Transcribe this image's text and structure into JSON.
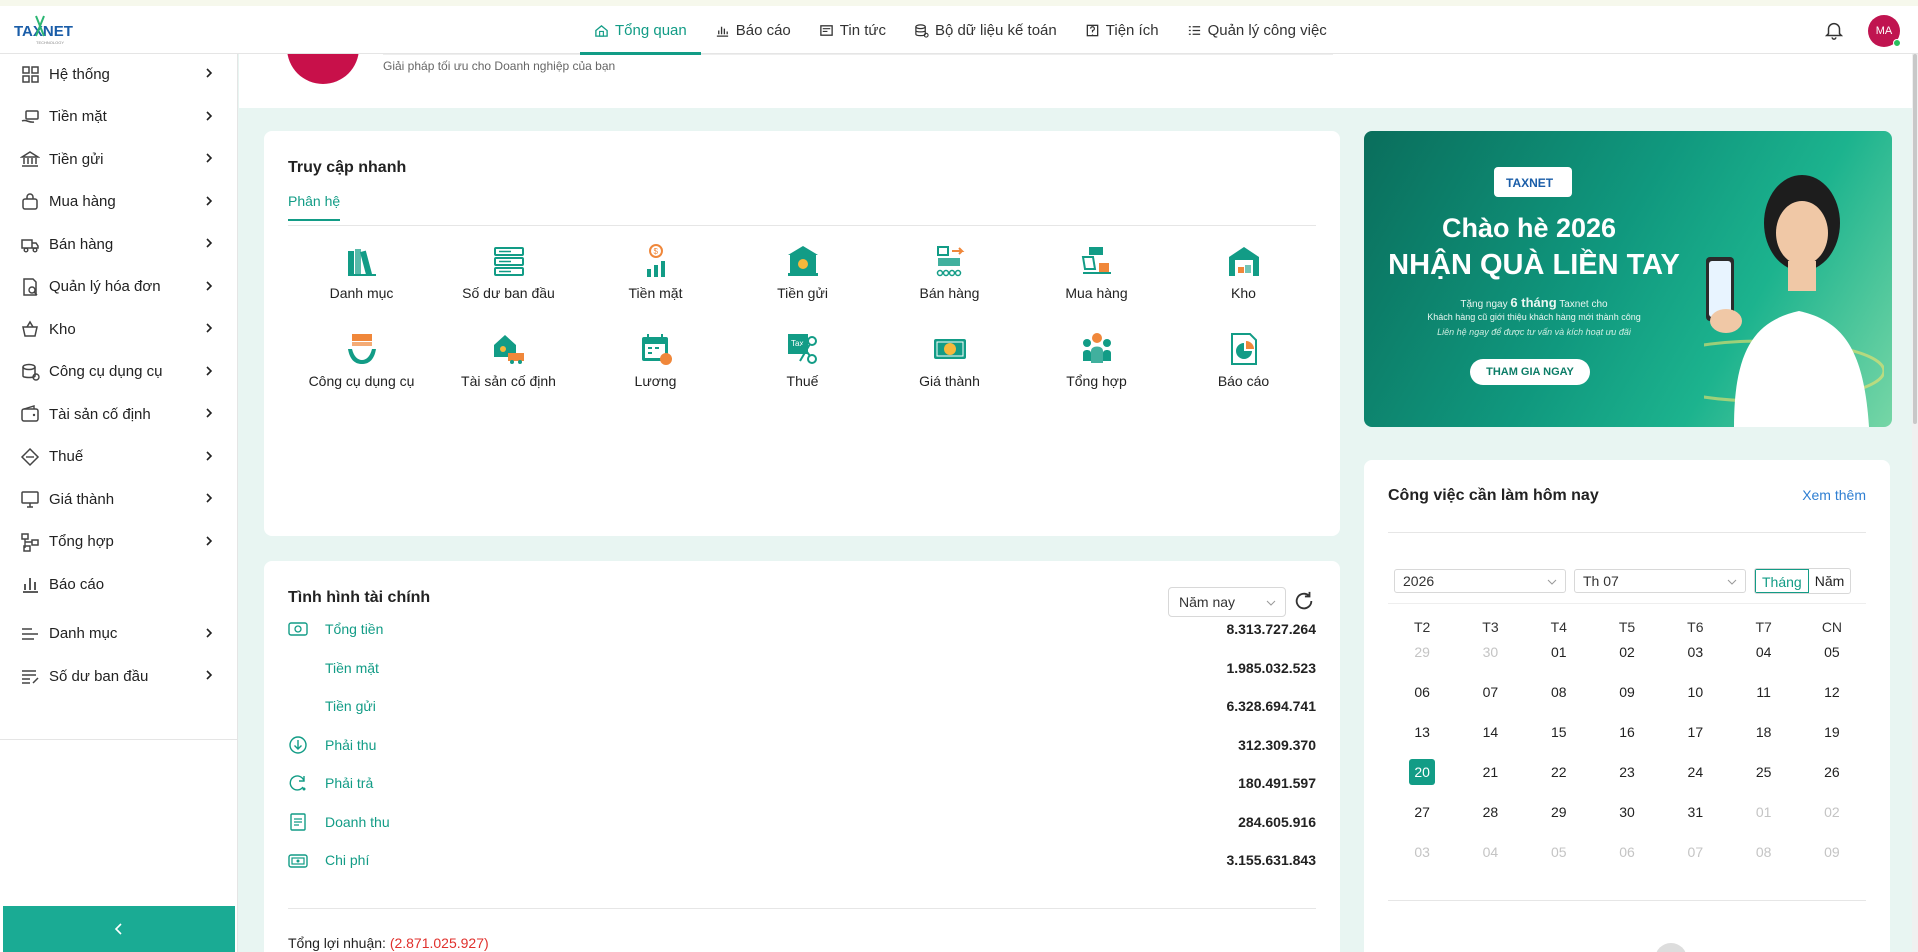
{
  "app": {
    "logo_text": "TAXNET"
  },
  "topnav": [
    {
      "label": "Tổng quan",
      "icon": "home-icon",
      "active": true
    },
    {
      "label": "Báo cáo",
      "icon": "chart-icon",
      "active": false
    },
    {
      "label": "Tin tức",
      "icon": "news-icon",
      "active": false
    },
    {
      "label": "Bộ dữ liệu kế toán",
      "icon": "database-icon",
      "active": false
    },
    {
      "label": "Tiện ích",
      "icon": "utility-icon",
      "active": false
    },
    {
      "label": "Quản lý công việc",
      "icon": "list-icon",
      "active": false
    }
  ],
  "user": {
    "initials": "MA"
  },
  "header": {
    "subtitle": "Giải pháp tối ưu cho Doanh nghiệp của bạn"
  },
  "sidebar": {
    "items": [
      {
        "label": "Hệ thống",
        "icon": "grid-icon",
        "chevron": true
      },
      {
        "label": "Tiền mặt",
        "icon": "cash-hand-icon",
        "chevron": true
      },
      {
        "label": "Tiền gửi",
        "icon": "bank-icon",
        "chevron": true
      },
      {
        "label": "Mua hàng",
        "icon": "bag-icon",
        "chevron": true
      },
      {
        "label": "Bán hàng",
        "icon": "truck-icon",
        "chevron": true
      },
      {
        "label": "Quản lý hóa đơn",
        "icon": "invoice-search-icon",
        "chevron": true
      },
      {
        "label": "Kho",
        "icon": "basket-icon",
        "chevron": true
      },
      {
        "label": "Công cụ dụng cụ",
        "icon": "tools-icon",
        "chevron": true
      },
      {
        "label": "Tài sản cố định",
        "icon": "wallet-icon",
        "chevron": true
      },
      {
        "label": "Thuế",
        "icon": "tag-icon",
        "chevron": true
      },
      {
        "label": "Giá thành",
        "icon": "monitor-icon",
        "chevron": true
      },
      {
        "label": "Tổng hợp",
        "icon": "hierarchy-icon",
        "chevron": true
      },
      {
        "label": "Báo cáo",
        "icon": "bar-chart-icon",
        "chevron": false
      },
      {
        "label": "Danh mục",
        "icon": "list-lines-icon",
        "chevron": true
      },
      {
        "label": "Số dư ban đầu",
        "icon": "list-edit-icon",
        "chevron": true
      }
    ]
  },
  "quick_access": {
    "title": "Truy cập nhanh",
    "tab": "Phân hệ",
    "items": [
      {
        "label": "Danh mục",
        "icon": "books-icon"
      },
      {
        "label": "Số dư ban đầu",
        "icon": "server-icon"
      },
      {
        "label": "Tiền mặt",
        "icon": "coin-growth-icon"
      },
      {
        "label": "Tiền gửi",
        "icon": "bank-building-icon"
      },
      {
        "label": "Bán hàng",
        "icon": "conveyor-icon"
      },
      {
        "label": "Mua hàng",
        "icon": "cart-truck-icon"
      },
      {
        "label": "Kho",
        "icon": "warehouse-icon"
      },
      {
        "label": "Công cụ dụng cụ",
        "icon": "toolbox-icon"
      },
      {
        "label": "Tài sản cố định",
        "icon": "house-truck-icon"
      },
      {
        "label": "Lương",
        "icon": "calendar-money-icon"
      },
      {
        "label": "Thuế",
        "icon": "tax-scissors-icon"
      },
      {
        "label": "Giá thành",
        "icon": "money-bill-icon"
      },
      {
        "label": "Tổng hợp",
        "icon": "team-icon"
      },
      {
        "label": "Báo cáo",
        "icon": "report-pie-icon"
      }
    ]
  },
  "finance": {
    "title": "Tình hình tài chính",
    "period": "Năm nay",
    "rows": [
      {
        "label": "Tổng tiền",
        "value": "8.313.727.264",
        "icon": "cash-icon"
      },
      {
        "label": "Tiền mặt",
        "value": "1.985.032.523",
        "icon": ""
      },
      {
        "label": "Tiền gửi",
        "value": "6.328.694.741",
        "icon": ""
      },
      {
        "label": "Phải thu",
        "value": "312.309.370",
        "icon": "arrow-down-circle-icon"
      },
      {
        "label": "Phải trả",
        "value": "180.491.597",
        "icon": "refresh-circle-icon"
      },
      {
        "label": "Doanh thu",
        "value": "284.605.916",
        "icon": "document-icon"
      },
      {
        "label": "Chi phí",
        "value": "3.155.631.843",
        "icon": "wallet-cash-icon"
      }
    ],
    "profit_label": "Tổng lợi nhuận:",
    "profit_value": "(2.871.025.927)"
  },
  "banner": {
    "logo_text": "TAXNET",
    "headline_1": "Chào hè 2026",
    "headline_2": "NHẬN QUÀ LIỀN TAY",
    "line_1_pre": "Tặng ngay",
    "line_1_bold": "6 tháng",
    "line_1_post": "Taxnet cho",
    "line_2": "Khách hàng cũ giới thiệu khách hàng mới thành công",
    "line_3": "Liên hệ ngay để được tư vấn và kích hoạt ưu đãi",
    "button": "THAM GIA NGAY"
  },
  "calendar": {
    "title": "Công việc cần làm hôm nay",
    "more": "Xem thêm",
    "year": "2026",
    "month": "Th 07",
    "view_month": "Tháng",
    "view_year": "Năm",
    "weekdays": [
      "T2",
      "T3",
      "T4",
      "T5",
      "T6",
      "T7",
      "CN"
    ],
    "days": [
      [
        "29",
        "30",
        "01",
        "02",
        "03",
        "04",
        "05"
      ],
      [
        "06",
        "07",
        "08",
        "09",
        "10",
        "11",
        "12"
      ],
      [
        "13",
        "14",
        "15",
        "16",
        "17",
        "18",
        "19"
      ],
      [
        "20",
        "21",
        "22",
        "23",
        "24",
        "25",
        "26"
      ],
      [
        "27",
        "28",
        "29",
        "30",
        "31",
        "01",
        "02"
      ],
      [
        "03",
        "04",
        "05",
        "06",
        "07",
        "08",
        "09"
      ]
    ],
    "muted": [
      [
        0,
        0
      ],
      [
        0,
        1
      ],
      [
        4,
        5
      ],
      [
        4,
        6
      ],
      [
        5,
        0
      ],
      [
        5,
        1
      ],
      [
        5,
        2
      ],
      [
        5,
        3
      ],
      [
        5,
        4
      ],
      [
        5,
        5
      ],
      [
        5,
        6
      ]
    ],
    "today": [
      3,
      0
    ]
  },
  "colors": {
    "accent": "#129c86",
    "negative": "#e0302c",
    "link": "#2f7fd2",
    "avatar": "#c01450"
  }
}
